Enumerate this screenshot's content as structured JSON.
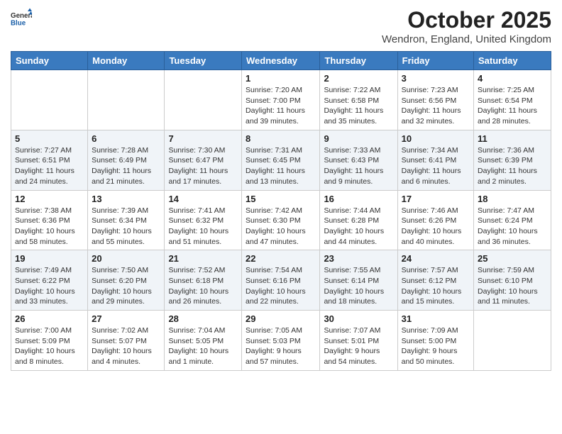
{
  "header": {
    "logo_general": "General",
    "logo_blue": "Blue",
    "month": "October 2025",
    "location": "Wendron, England, United Kingdom"
  },
  "days_of_week": [
    "Sunday",
    "Monday",
    "Tuesday",
    "Wednesday",
    "Thursday",
    "Friday",
    "Saturday"
  ],
  "weeks": [
    [
      {
        "day": "",
        "info": ""
      },
      {
        "day": "",
        "info": ""
      },
      {
        "day": "",
        "info": ""
      },
      {
        "day": "1",
        "info": "Sunrise: 7:20 AM\nSunset: 7:00 PM\nDaylight: 11 hours\nand 39 minutes."
      },
      {
        "day": "2",
        "info": "Sunrise: 7:22 AM\nSunset: 6:58 PM\nDaylight: 11 hours\nand 35 minutes."
      },
      {
        "day": "3",
        "info": "Sunrise: 7:23 AM\nSunset: 6:56 PM\nDaylight: 11 hours\nand 32 minutes."
      },
      {
        "day": "4",
        "info": "Sunrise: 7:25 AM\nSunset: 6:54 PM\nDaylight: 11 hours\nand 28 minutes."
      }
    ],
    [
      {
        "day": "5",
        "info": "Sunrise: 7:27 AM\nSunset: 6:51 PM\nDaylight: 11 hours\nand 24 minutes."
      },
      {
        "day": "6",
        "info": "Sunrise: 7:28 AM\nSunset: 6:49 PM\nDaylight: 11 hours\nand 21 minutes."
      },
      {
        "day": "7",
        "info": "Sunrise: 7:30 AM\nSunset: 6:47 PM\nDaylight: 11 hours\nand 17 minutes."
      },
      {
        "day": "8",
        "info": "Sunrise: 7:31 AM\nSunset: 6:45 PM\nDaylight: 11 hours\nand 13 minutes."
      },
      {
        "day": "9",
        "info": "Sunrise: 7:33 AM\nSunset: 6:43 PM\nDaylight: 11 hours\nand 9 minutes."
      },
      {
        "day": "10",
        "info": "Sunrise: 7:34 AM\nSunset: 6:41 PM\nDaylight: 11 hours\nand 6 minutes."
      },
      {
        "day": "11",
        "info": "Sunrise: 7:36 AM\nSunset: 6:39 PM\nDaylight: 11 hours\nand 2 minutes."
      }
    ],
    [
      {
        "day": "12",
        "info": "Sunrise: 7:38 AM\nSunset: 6:36 PM\nDaylight: 10 hours\nand 58 minutes."
      },
      {
        "day": "13",
        "info": "Sunrise: 7:39 AM\nSunset: 6:34 PM\nDaylight: 10 hours\nand 55 minutes."
      },
      {
        "day": "14",
        "info": "Sunrise: 7:41 AM\nSunset: 6:32 PM\nDaylight: 10 hours\nand 51 minutes."
      },
      {
        "day": "15",
        "info": "Sunrise: 7:42 AM\nSunset: 6:30 PM\nDaylight: 10 hours\nand 47 minutes."
      },
      {
        "day": "16",
        "info": "Sunrise: 7:44 AM\nSunset: 6:28 PM\nDaylight: 10 hours\nand 44 minutes."
      },
      {
        "day": "17",
        "info": "Sunrise: 7:46 AM\nSunset: 6:26 PM\nDaylight: 10 hours\nand 40 minutes."
      },
      {
        "day": "18",
        "info": "Sunrise: 7:47 AM\nSunset: 6:24 PM\nDaylight: 10 hours\nand 36 minutes."
      }
    ],
    [
      {
        "day": "19",
        "info": "Sunrise: 7:49 AM\nSunset: 6:22 PM\nDaylight: 10 hours\nand 33 minutes."
      },
      {
        "day": "20",
        "info": "Sunrise: 7:50 AM\nSunset: 6:20 PM\nDaylight: 10 hours\nand 29 minutes."
      },
      {
        "day": "21",
        "info": "Sunrise: 7:52 AM\nSunset: 6:18 PM\nDaylight: 10 hours\nand 26 minutes."
      },
      {
        "day": "22",
        "info": "Sunrise: 7:54 AM\nSunset: 6:16 PM\nDaylight: 10 hours\nand 22 minutes."
      },
      {
        "day": "23",
        "info": "Sunrise: 7:55 AM\nSunset: 6:14 PM\nDaylight: 10 hours\nand 18 minutes."
      },
      {
        "day": "24",
        "info": "Sunrise: 7:57 AM\nSunset: 6:12 PM\nDaylight: 10 hours\nand 15 minutes."
      },
      {
        "day": "25",
        "info": "Sunrise: 7:59 AM\nSunset: 6:10 PM\nDaylight: 10 hours\nand 11 minutes."
      }
    ],
    [
      {
        "day": "26",
        "info": "Sunrise: 7:00 AM\nSunset: 5:09 PM\nDaylight: 10 hours\nand 8 minutes."
      },
      {
        "day": "27",
        "info": "Sunrise: 7:02 AM\nSunset: 5:07 PM\nDaylight: 10 hours\nand 4 minutes."
      },
      {
        "day": "28",
        "info": "Sunrise: 7:04 AM\nSunset: 5:05 PM\nDaylight: 10 hours\nand 1 minute."
      },
      {
        "day": "29",
        "info": "Sunrise: 7:05 AM\nSunset: 5:03 PM\nDaylight: 9 hours\nand 57 minutes."
      },
      {
        "day": "30",
        "info": "Sunrise: 7:07 AM\nSunset: 5:01 PM\nDaylight: 9 hours\nand 54 minutes."
      },
      {
        "day": "31",
        "info": "Sunrise: 7:09 AM\nSunset: 5:00 PM\nDaylight: 9 hours\nand 50 minutes."
      },
      {
        "day": "",
        "info": ""
      }
    ]
  ]
}
